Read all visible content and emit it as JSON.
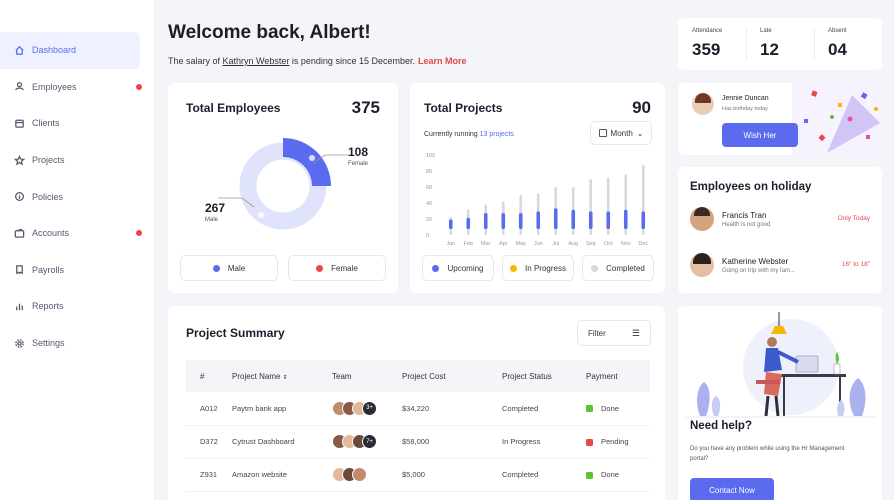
{
  "sidebar": {
    "items": [
      {
        "label": "Dashboard",
        "icon": "home-icon",
        "active": true,
        "dot": false
      },
      {
        "label": "Employees",
        "icon": "user-icon",
        "active": false,
        "dot": true
      },
      {
        "label": "Clients",
        "icon": "calendar-icon",
        "active": false,
        "dot": false
      },
      {
        "label": "Projects",
        "icon": "star-icon",
        "active": false,
        "dot": false
      },
      {
        "label": "Policies",
        "icon": "info-icon",
        "active": false,
        "dot": false
      },
      {
        "label": "Accounts",
        "icon": "wallet-icon",
        "active": false,
        "dot": true
      },
      {
        "label": "Payrolls",
        "icon": "payroll-icon",
        "active": false,
        "dot": false
      },
      {
        "label": "Reports",
        "icon": "bar-chart-icon",
        "active": false,
        "dot": false
      },
      {
        "label": "Settings",
        "icon": "gear-icon",
        "active": false,
        "dot": false
      }
    ]
  },
  "welcome": {
    "title": "Welcome back, Albert!",
    "msg_before": "The salary of ",
    "msg_name": "Kathryn Webster",
    "msg_after": " is pending since 15 December.",
    "learn_more": "Learn More"
  },
  "stats": [
    {
      "label": "Attendance",
      "value": "359"
    },
    {
      "label": "Late",
      "value": "12"
    },
    {
      "label": "Absent",
      "value": "04"
    }
  ],
  "total_employees": {
    "title": "Total Employees",
    "value": "375",
    "female_value": "108",
    "female_label": "Female",
    "male_value": "267",
    "male_label": "Male",
    "legend_male": "Male",
    "legend_female": "Female"
  },
  "total_projects": {
    "title": "Total Projects",
    "value": "90",
    "running_prefix": "Currently running",
    "running_link": "13 projects",
    "period": "Month",
    "legend": [
      "Upcoming",
      "In Progress",
      "Completed"
    ]
  },
  "chart_data": {
    "type": "bar",
    "categories": [
      "Jan",
      "Feb",
      "Mar",
      "Apr",
      "May",
      "Jun",
      "Jul",
      "Aug",
      "Sep",
      "Oct",
      "Nov",
      "Dec"
    ],
    "yticks": [
      "100",
      "80",
      "60",
      "40",
      "20",
      "0"
    ],
    "ylim": [
      0,
      100
    ],
    "totals": [
      22,
      32,
      38,
      42,
      50,
      52,
      60,
      60,
      70,
      72,
      76,
      88
    ],
    "filled": [
      12,
      14,
      20,
      20,
      20,
      22,
      26,
      24,
      22,
      22,
      24,
      22
    ]
  },
  "jennie": {
    "name": "Jennie Duncan",
    "sub": "Has birthday today",
    "button": "Wish Her"
  },
  "holiday": {
    "title": "Employees on holiday",
    "people": [
      {
        "name": "Francis Tran",
        "sub": "Health is not good",
        "when": "Only Today"
      },
      {
        "name": "Katherine Webster",
        "sub": "Going on trip with my fam...",
        "when": "16\" to 18\""
      }
    ]
  },
  "summary": {
    "title": "Project Summary",
    "filter": "Filter",
    "headers": [
      "#",
      "Project Name",
      "Team",
      "Project Cost",
      "Project Status",
      "Payment"
    ],
    "rows": [
      {
        "id": "A012",
        "name": "Paytm bank app",
        "team_more": "3+",
        "cost": "$34,220",
        "status": "Completed",
        "payment": "Done",
        "pay_color": "#5bc236"
      },
      {
        "id": "D372",
        "name": "Cytrust Dashboard",
        "team_more": "7+",
        "cost": "$58,000",
        "status": "In Progress",
        "payment": "Pending",
        "pay_color": "#e5484d"
      },
      {
        "id": "Z931",
        "name": "Amazon website",
        "team_more": "",
        "cost": "$5,000",
        "status": "Completed",
        "payment": "Done",
        "pay_color": "#5bc236"
      }
    ]
  },
  "help": {
    "title": "Need help?",
    "text": "Do you have any problem while using the Hr Management portal?",
    "button": "Contact Now"
  },
  "colors": {
    "accent": "#5b6bf0",
    "donut_light": "#dfe3fb",
    "red": "#e5484d",
    "yellow": "#f5b800",
    "grey": "#d8d9de"
  }
}
